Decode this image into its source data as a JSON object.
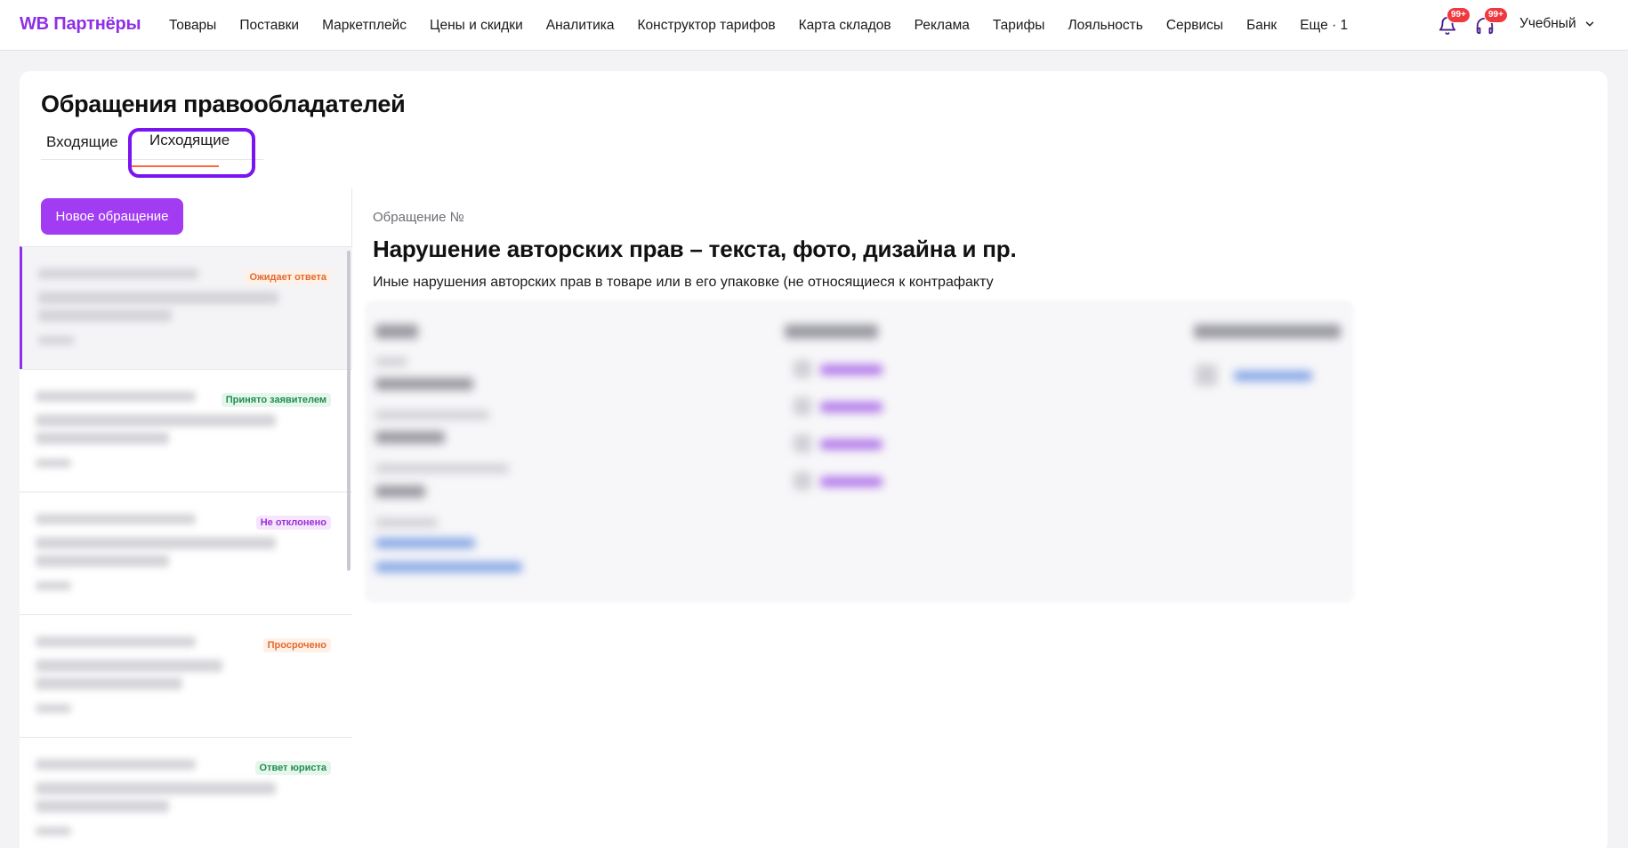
{
  "topbar": {
    "logo": "WB Партнёры",
    "nav": [
      "Товары",
      "Поставки",
      "Маркетплейс",
      "Цены и скидки",
      "Аналитика",
      "Конструктор тарифов",
      "Карта складов",
      "Реклама",
      "Тарифы",
      "Лояльность",
      "Сервисы",
      "Банк",
      "Еще · 1"
    ],
    "notifications_badge": "99+",
    "support_badge": "99+",
    "account": "Учебный"
  },
  "page": {
    "title": "Обращения правообладателей",
    "tabs": {
      "incoming": "Входящие",
      "outgoing": "Исходящие"
    }
  },
  "list": {
    "new_button": "Новое обращение",
    "statuses": [
      "Ожидает ответа",
      "Принято заявителем",
      "Не отклонено",
      "Просрочено",
      "Ответ юриста"
    ]
  },
  "detail": {
    "label": "Обращение №",
    "title": "Нарушение авторских прав – текста, фото, дизайна и пр.",
    "description": "Иные нарушения авторских прав в товаре или в его упаковке (не относящиеся к контрафакту"
  },
  "colors": {
    "brand": "#8f2fe8",
    "button": "#a23cf3",
    "tab_underline": "#ff6a3d",
    "highlight": "#7a14f0",
    "badge": "#f0383f"
  }
}
